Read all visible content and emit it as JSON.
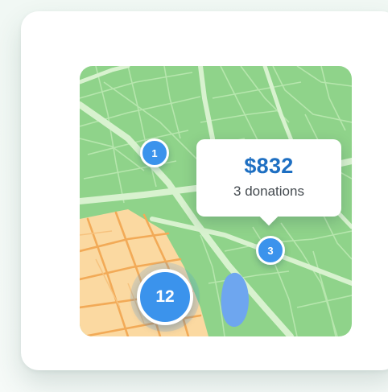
{
  "map": {
    "colors": {
      "land": "#8fd38a",
      "district": "#fbd9a1",
      "road": "#d8f2cf",
      "district_road": "#f2aa57",
      "water": "#6ea6ef",
      "marker": "#3b93ec"
    },
    "markers": [
      {
        "label": "1"
      },
      {
        "label": "3"
      },
      {
        "label": "12"
      }
    ],
    "popup": {
      "amount": "$832",
      "donations": "3 donations"
    }
  }
}
